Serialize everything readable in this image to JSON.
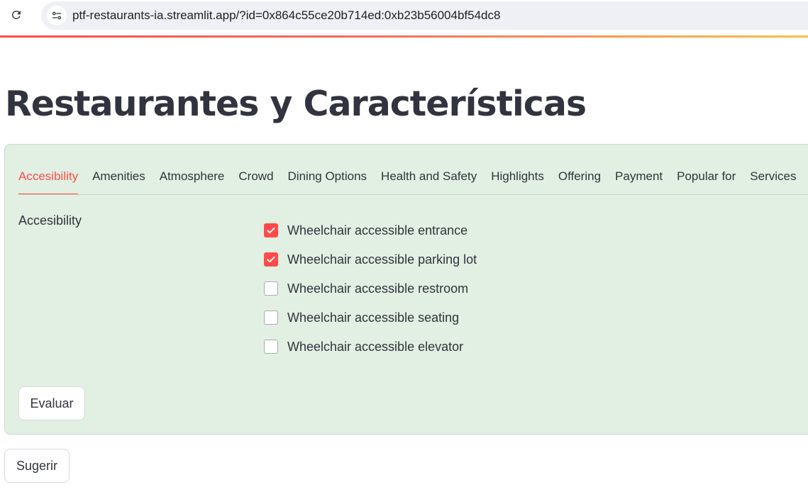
{
  "browser": {
    "url": "ptf-restaurants-ia.streamlit.app/?id=0x864c55ce20b714ed:0xb23b56004bf54dc8",
    "reload_icon": "reload-icon",
    "site_info_icon": "tune-icon"
  },
  "colors": {
    "accent": "#ff4b4b",
    "form_background": "#e1f0e2",
    "text": "#31333f"
  },
  "page": {
    "title": "Restaurantes y Características"
  },
  "form": {
    "tabs": [
      {
        "label": "Accesibility",
        "active": true
      },
      {
        "label": "Amenities",
        "active": false
      },
      {
        "label": "Atmosphere",
        "active": false
      },
      {
        "label": "Crowd",
        "active": false
      },
      {
        "label": "Dining Options",
        "active": false
      },
      {
        "label": "Health and Safety",
        "active": false
      },
      {
        "label": "Highlights",
        "active": false
      },
      {
        "label": "Offering",
        "active": false
      },
      {
        "label": "Payment",
        "active": false
      },
      {
        "label": "Popular for",
        "active": false
      },
      {
        "label": "Services",
        "active": false
      }
    ],
    "field_label": "Accesibility",
    "options": [
      {
        "label": "Wheelchair accessible entrance",
        "checked": true
      },
      {
        "label": "Wheelchair accessible parking lot",
        "checked": true
      },
      {
        "label": "Wheelchair accessible restroom",
        "checked": false
      },
      {
        "label": "Wheelchair accessible seating",
        "checked": false
      },
      {
        "label": "Wheelchair accessible elevator",
        "checked": false
      }
    ],
    "evaluate_label": "Evaluar"
  },
  "suggest_label": "Sugerir"
}
